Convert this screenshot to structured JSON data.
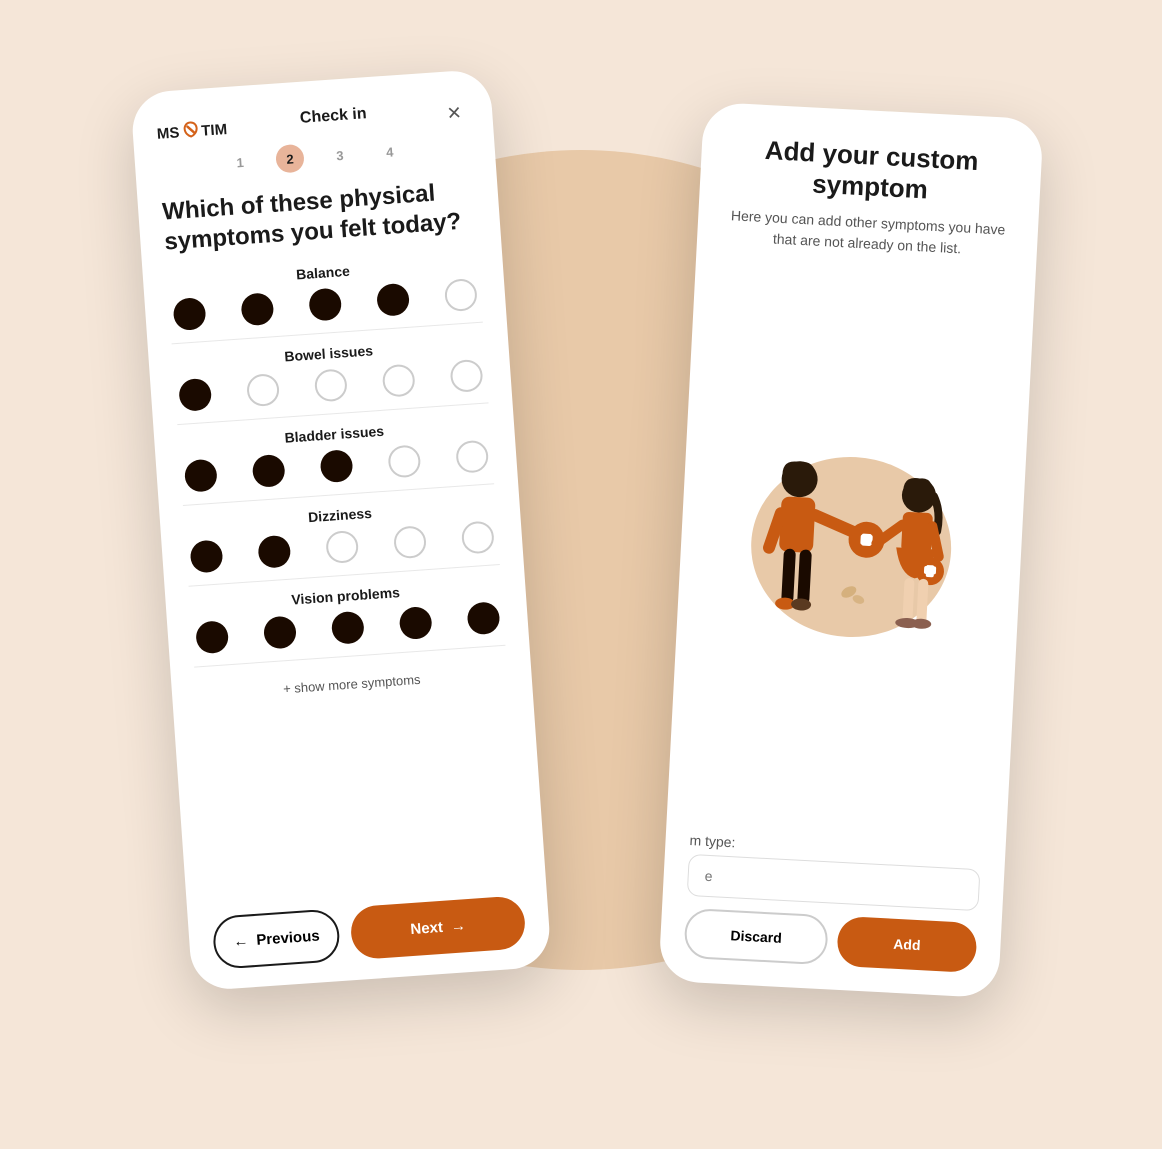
{
  "app": {
    "logo": {
      "ms": "MS",
      "ribbon": "✕",
      "tim": "TIM"
    },
    "close_label": "✕"
  },
  "phone1": {
    "checkin_title": "Check in",
    "steps": [
      {
        "label": "1",
        "state": "inactive"
      },
      {
        "label": "2",
        "state": "active"
      },
      {
        "label": "3",
        "state": "inactive"
      },
      {
        "label": "4",
        "state": "inactive"
      }
    ],
    "question": "Which of these physical symptoms you felt today?",
    "symptoms": [
      {
        "name": "Balance",
        "dots": [
          "filled",
          "filled",
          "filled",
          "filled",
          "empty"
        ]
      },
      {
        "name": "Bowel issues",
        "dots": [
          "filled",
          "empty",
          "empty",
          "empty",
          "empty"
        ]
      },
      {
        "name": "Bladder issues",
        "dots": [
          "filled",
          "filled",
          "filled",
          "empty",
          "empty"
        ]
      },
      {
        "name": "Dizziness",
        "dots": [
          "filled",
          "filled",
          "empty",
          "empty",
          "empty"
        ]
      },
      {
        "name": "Vision problems",
        "dots": [
          "filled",
          "filled",
          "filled",
          "filled",
          "filled"
        ]
      }
    ],
    "show_more_label": "+ show more symptoms",
    "prev_label": "Previous",
    "next_label": "Next"
  },
  "phone2": {
    "title": "Add your custom symptom",
    "subtitle": "Here you can add other symptoms you have that are not already on the list.",
    "symptom_type_label": "m type:",
    "symptom_type_placeholder": "e",
    "discard_label": "Discard",
    "add_label": "Add"
  }
}
